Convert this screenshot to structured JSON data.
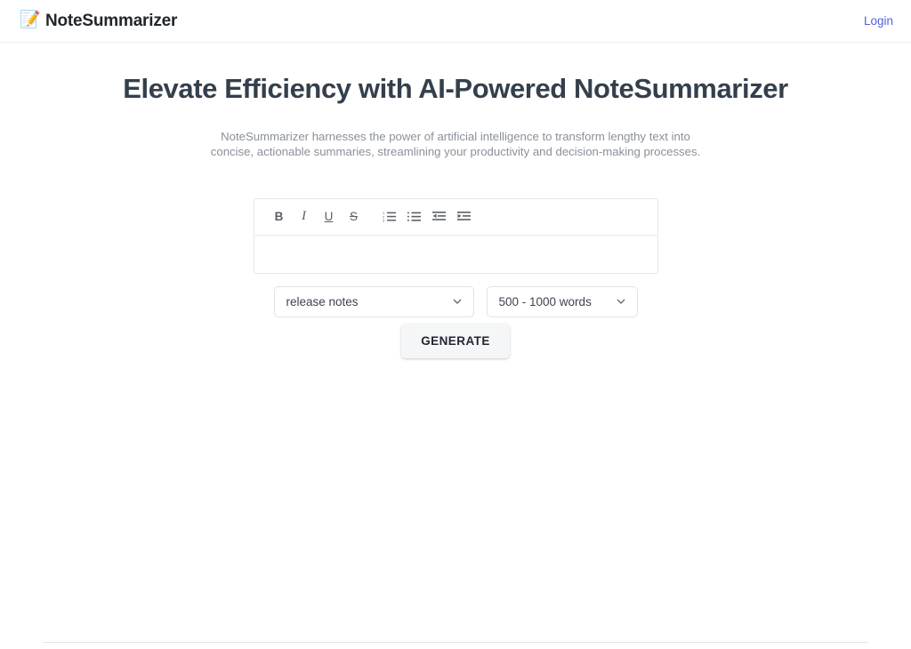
{
  "header": {
    "brand_icon": "memo-icon",
    "brand_name": "NoteSummarizer",
    "login_label": "Login",
    "login_color": "#4f62e0"
  },
  "hero": {
    "title": "Elevate Efficiency with AI-Powered NoteSummarizer",
    "subtitle": "NoteSummarizer harnesses the power of artificial intelligence to transform lengthy text into concise, actionable summaries, streamlining your productivity and decision-making processes.",
    "title_color": "#353f4c",
    "subtitle_color": "#8a9099"
  },
  "editor": {
    "toolbar": [
      {
        "name": "bold-icon",
        "label": "B"
      },
      {
        "name": "italic-icon",
        "label": "I"
      },
      {
        "name": "underline-icon",
        "label": "U"
      },
      {
        "name": "strikethrough-icon",
        "label": "S"
      },
      {
        "name": "ordered-list-icon",
        "label": ""
      },
      {
        "name": "unordered-list-icon",
        "label": ""
      },
      {
        "name": "outdent-icon",
        "label": ""
      },
      {
        "name": "indent-icon",
        "label": ""
      }
    ],
    "content": "",
    "placeholder": ""
  },
  "controls": {
    "topic_select": {
      "value": "release notes",
      "options": [
        "release notes"
      ]
    },
    "length_select": {
      "value": "500 - 1000 words",
      "options": [
        "500 - 1000 words"
      ]
    }
  },
  "actions": {
    "generate_label": "GENERATE"
  }
}
